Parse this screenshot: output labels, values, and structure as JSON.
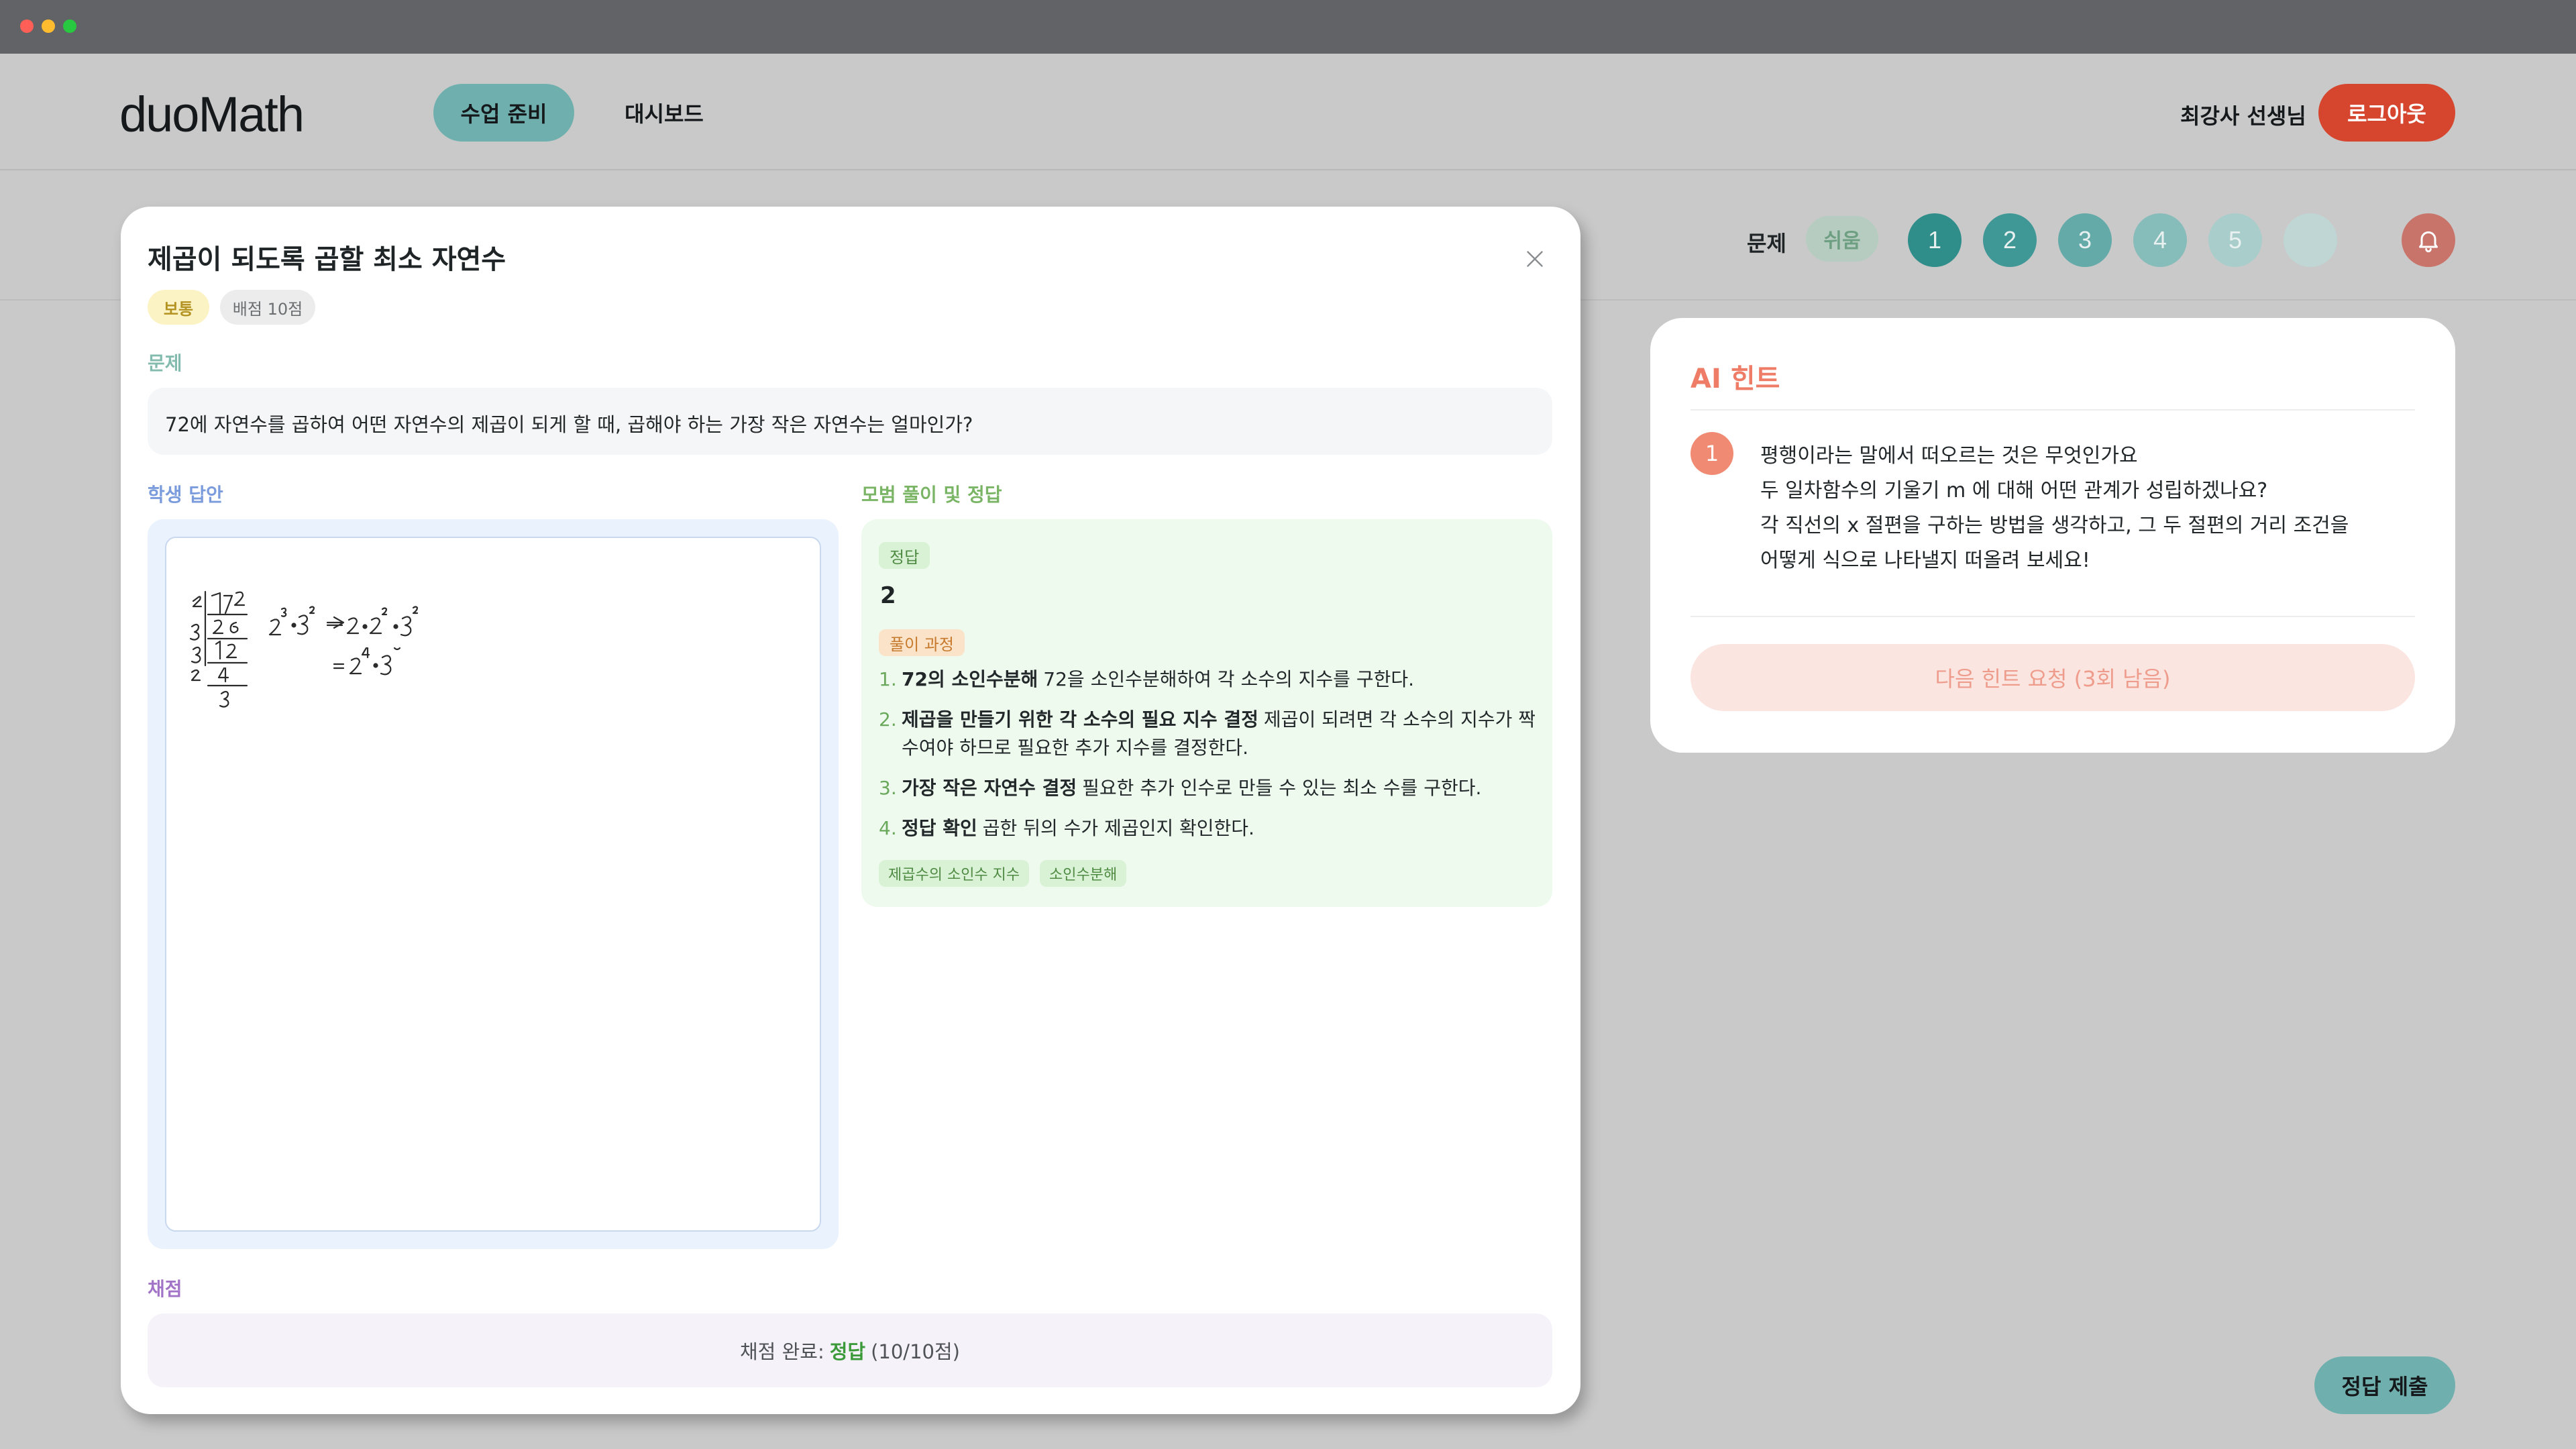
{
  "window": {
    "controls": [
      "close-dot",
      "minimize-dot",
      "maximize-dot"
    ]
  },
  "header": {
    "logo": "duoMath",
    "nav": [
      {
        "label": "수업 준비",
        "active": true
      },
      {
        "label": "대시보드",
        "active": false
      }
    ],
    "teacher_name": "최강사 선생님",
    "logout_label": "로그아웃"
  },
  "problem_strip": {
    "label": "문제",
    "difficulty": "쉬움",
    "numbers": [
      "1",
      "2",
      "3",
      "4",
      "5"
    ],
    "bell_icon": "bell-icon"
  },
  "ai_hint": {
    "title": "AI 힌트",
    "hint_number": "1",
    "lines": [
      "평행이라는 말에서 떠오르는 것은 무엇인가요",
      "두 일차함수의 기울기  m 에 대해 어떤 관계가 성립하겠나요?",
      "각 직선의 x 절편을 구하는 방법을 생각하고, 그 두 절편의 거리 조건을",
      "어떻게 식으로 나타낼지 떠올려 보세요!"
    ],
    "next_hint_label": "다음 힌트 요청 (3회 남음)"
  },
  "submit_label": "정답 제출",
  "modal": {
    "title": "제곱이 되도록 곱할 최소 자연수",
    "level_badge": "보통",
    "score_badge": "배점 10점",
    "problem_label": "문제",
    "problem_text": "72에 자연수를 곱하여 어떤 자연수의 제곱이 되게 할 때, 곱해야 하는 가장 작은 자연수는 얼마인가?",
    "student_label": "학생 답안",
    "model_label": "모범 풀이 및 정답",
    "answer_tag": "정답",
    "answer_value": "2",
    "process_tag": "풀이 과정",
    "steps": [
      {
        "num": "1.",
        "strong": "72의 소인수분해",
        "text": "72을 소인수분해하여 각 소수의 지수를 구한다."
      },
      {
        "num": "2.",
        "strong": "제곱을 만들기 위한 각 소수의 필요 지수 결정",
        "text": "제곱이 되려면 각 소수의 지수가 짝수여야 하므로 필요한 추가 지수를 결정한다."
      },
      {
        "num": "3.",
        "strong": "가장 작은 자연수 결정",
        "text": "필요한 추가 인수로 만들 수 있는 최소 수를 구한다."
      },
      {
        "num": "4.",
        "strong": "정답 확인",
        "text": "곱한 뒤의 수가 제곱인지 확인한다."
      }
    ],
    "chips": [
      "제곱수의 소인수 지수",
      "소인수분해"
    ],
    "grading_label": "채점",
    "grading_prefix": "채점 완료:",
    "grading_result": "정답",
    "grading_suffix": "(10/10점)"
  },
  "colors": {
    "teal": "#6fb0ae",
    "logout_red": "#d6462f",
    "hint_orange": "#ee7c66",
    "correct_green": "#3d9a3a"
  }
}
